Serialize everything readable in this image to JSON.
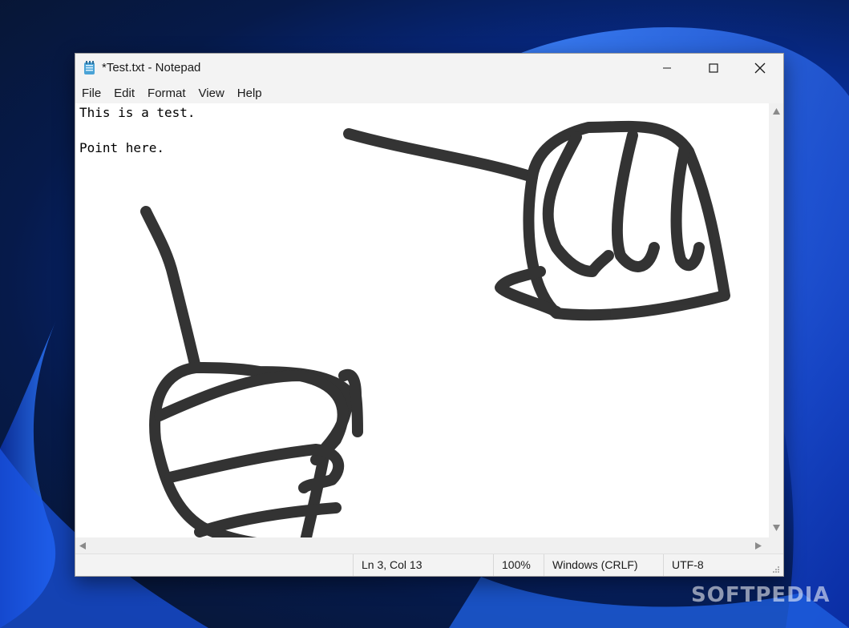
{
  "window": {
    "title": "*Test.txt - Notepad"
  },
  "menu": {
    "items": [
      "File",
      "Edit",
      "Format",
      "View",
      "Help"
    ]
  },
  "editor": {
    "lines": [
      "This is a test.",
      "",
      "Point here."
    ]
  },
  "status": {
    "position": "Ln 3, Col 13",
    "zoom": "100%",
    "line_ending": "Windows (CRLF)",
    "encoding": "UTF-8"
  },
  "watermark": "SOFTPEDIA",
  "icons": {
    "app": "notepad-icon",
    "minimize": "minimize-icon",
    "maximize": "maximize-icon",
    "close": "close-icon"
  },
  "colors": {
    "wallpaper_accent": "#1a55e8",
    "ink": "#2d2d2d"
  }
}
